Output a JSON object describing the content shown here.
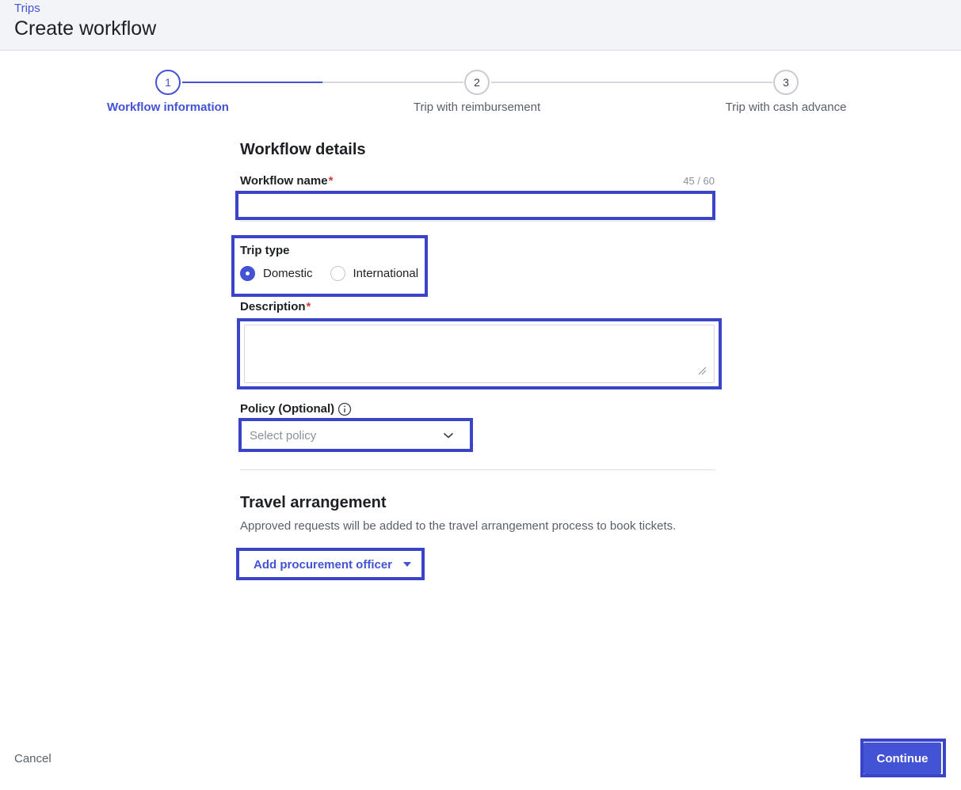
{
  "header": {
    "breadcrumb": "Trips",
    "title": "Create workflow"
  },
  "stepper": {
    "steps": [
      {
        "number": "1",
        "label": "Workflow information",
        "state": "active"
      },
      {
        "number": "2",
        "label": "Trip with reimbursement",
        "state": "upcoming"
      },
      {
        "number": "3",
        "label": "Trip with cash advance",
        "state": "upcoming"
      }
    ],
    "progress_first_segment": 0.5
  },
  "workflow_details": {
    "title": "Workflow details",
    "name_label": "Workflow name",
    "required_mark": "*",
    "name_value": "",
    "name_counter": "45 / 60",
    "trip_type_label": "Trip type",
    "trip_type_options": [
      "Domestic",
      "International"
    ],
    "trip_type_selected": "Domestic",
    "description_label": "Description",
    "description_value": "",
    "policy_label": "Policy (Optional)",
    "policy_placeholder": "Select policy"
  },
  "travel_arrangement": {
    "title": "Travel arrangement",
    "helper": "Approved requests will be added to the travel arrangement process to book tickets.",
    "add_button_label": "Add procurement officer"
  },
  "footer": {
    "cancel_label": "Cancel",
    "continue_label": "Continue"
  },
  "colors": {
    "accent": "#4353d6",
    "highlight_border": "#3a44c8",
    "required": "#d93838",
    "header_bg": "#f2f4f7"
  }
}
